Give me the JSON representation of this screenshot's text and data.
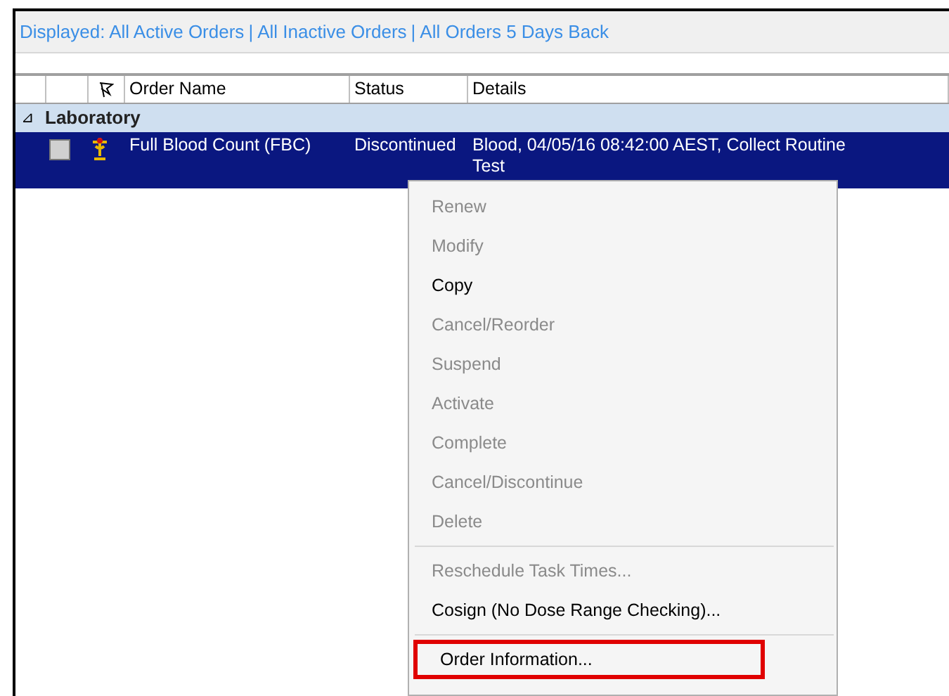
{
  "filter_bar": {
    "links": [
      "Displayed: All Active Orders",
      "All Inactive Orders",
      "All Orders 5 Days Back"
    ],
    "separator": "|"
  },
  "table": {
    "columns": [
      "Order Name",
      "Status",
      "Details"
    ],
    "groups": [
      {
        "label": "Laboratory",
        "expanded": true,
        "expander": "⊿",
        "rows": [
          {
            "order_name": "Full Blood Count (FBC)",
            "status": "Discontinued",
            "details": "Blood, 04/05/16 08:42:00 AEST, Collect Routine Test",
            "selected": true,
            "checked": false
          }
        ]
      }
    ]
  },
  "context_menu": [
    {
      "kind": "item",
      "label": "Renew",
      "disabled": true,
      "highlighted": false
    },
    {
      "kind": "item",
      "label": "Modify",
      "disabled": true,
      "highlighted": false
    },
    {
      "kind": "item",
      "label": "Copy",
      "disabled": false,
      "highlighted": false
    },
    {
      "kind": "item",
      "label": "Cancel/Reorder",
      "disabled": true,
      "highlighted": false
    },
    {
      "kind": "item",
      "label": "Suspend",
      "disabled": true,
      "highlighted": false
    },
    {
      "kind": "item",
      "label": "Activate",
      "disabled": true,
      "highlighted": false
    },
    {
      "kind": "item",
      "label": "Complete",
      "disabled": true,
      "highlighted": false
    },
    {
      "kind": "item",
      "label": "Cancel/Discontinue",
      "disabled": true,
      "highlighted": false
    },
    {
      "kind": "item",
      "label": "Delete",
      "disabled": true,
      "highlighted": false
    },
    {
      "kind": "separator"
    },
    {
      "kind": "item",
      "label": "Reschedule Task Times...",
      "disabled": true,
      "highlighted": false
    },
    {
      "kind": "item",
      "label": "Cosign (No Dose Range Checking)...",
      "disabled": false,
      "highlighted": false
    },
    {
      "kind": "separator"
    },
    {
      "kind": "item",
      "label": "Order Information...",
      "disabled": false,
      "highlighted": true
    }
  ]
}
